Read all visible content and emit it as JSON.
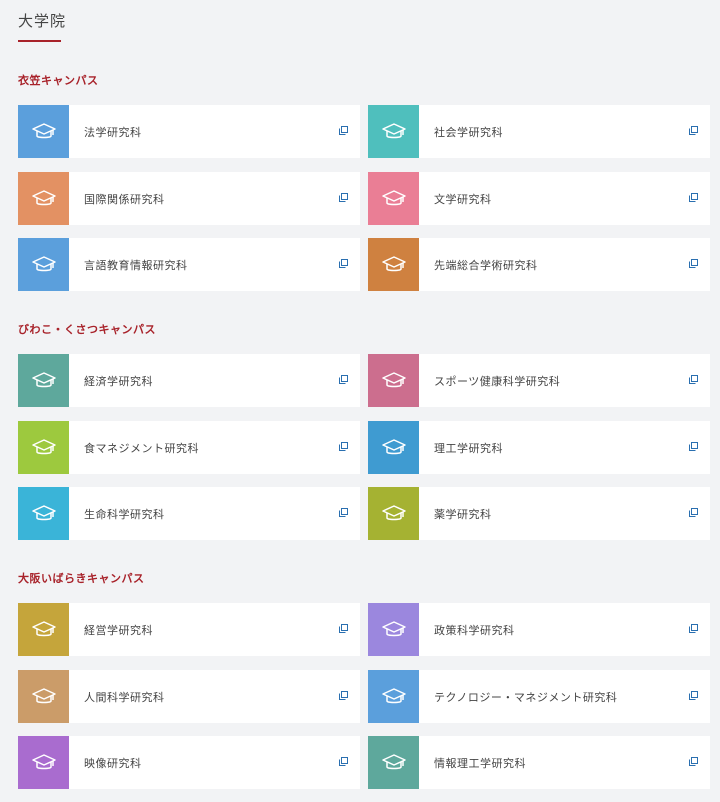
{
  "page_title": "大学院",
  "sections": [
    {
      "heading": "衣笠キャンパス",
      "items": [
        {
          "label": "法学研究科",
          "color": "#5b9fdc"
        },
        {
          "label": "社会学研究科",
          "color": "#4fbfbd"
        },
        {
          "label": "国際関係研究科",
          "color": "#e39163"
        },
        {
          "label": "文学研究科",
          "color": "#ea7e95"
        },
        {
          "label": "言語教育情報研究科",
          "color": "#5b9fdc"
        },
        {
          "label": "先端総合学術研究科",
          "color": "#cf8140"
        }
      ]
    },
    {
      "heading": "びわこ・くさつキャンパス",
      "items": [
        {
          "label": "経済学研究科",
          "color": "#5ea89c"
        },
        {
          "label": "スポーツ健康科学研究科",
          "color": "#cc6e8e"
        },
        {
          "label": "食マネジメント研究科",
          "color": "#9dc93e"
        },
        {
          "label": "理工学研究科",
          "color": "#3f9bd1"
        },
        {
          "label": "生命科学研究科",
          "color": "#3ab4d8"
        },
        {
          "label": "薬学研究科",
          "color": "#a5b232"
        }
      ]
    },
    {
      "heading": "大阪いばらきキャンパス",
      "items": [
        {
          "label": "経営学研究科",
          "color": "#c5a53b"
        },
        {
          "label": "政策科学研究科",
          "color": "#9b87de"
        },
        {
          "label": "人間科学研究科",
          "color": "#cb9c69"
        },
        {
          "label": "テクノロジー・マネジメント研究科",
          "color": "#5b9fdc"
        },
        {
          "label": "映像研究科",
          "color": "#a96ccf"
        },
        {
          "label": "情報理工学研究科",
          "color": "#5ea89c"
        }
      ]
    }
  ]
}
